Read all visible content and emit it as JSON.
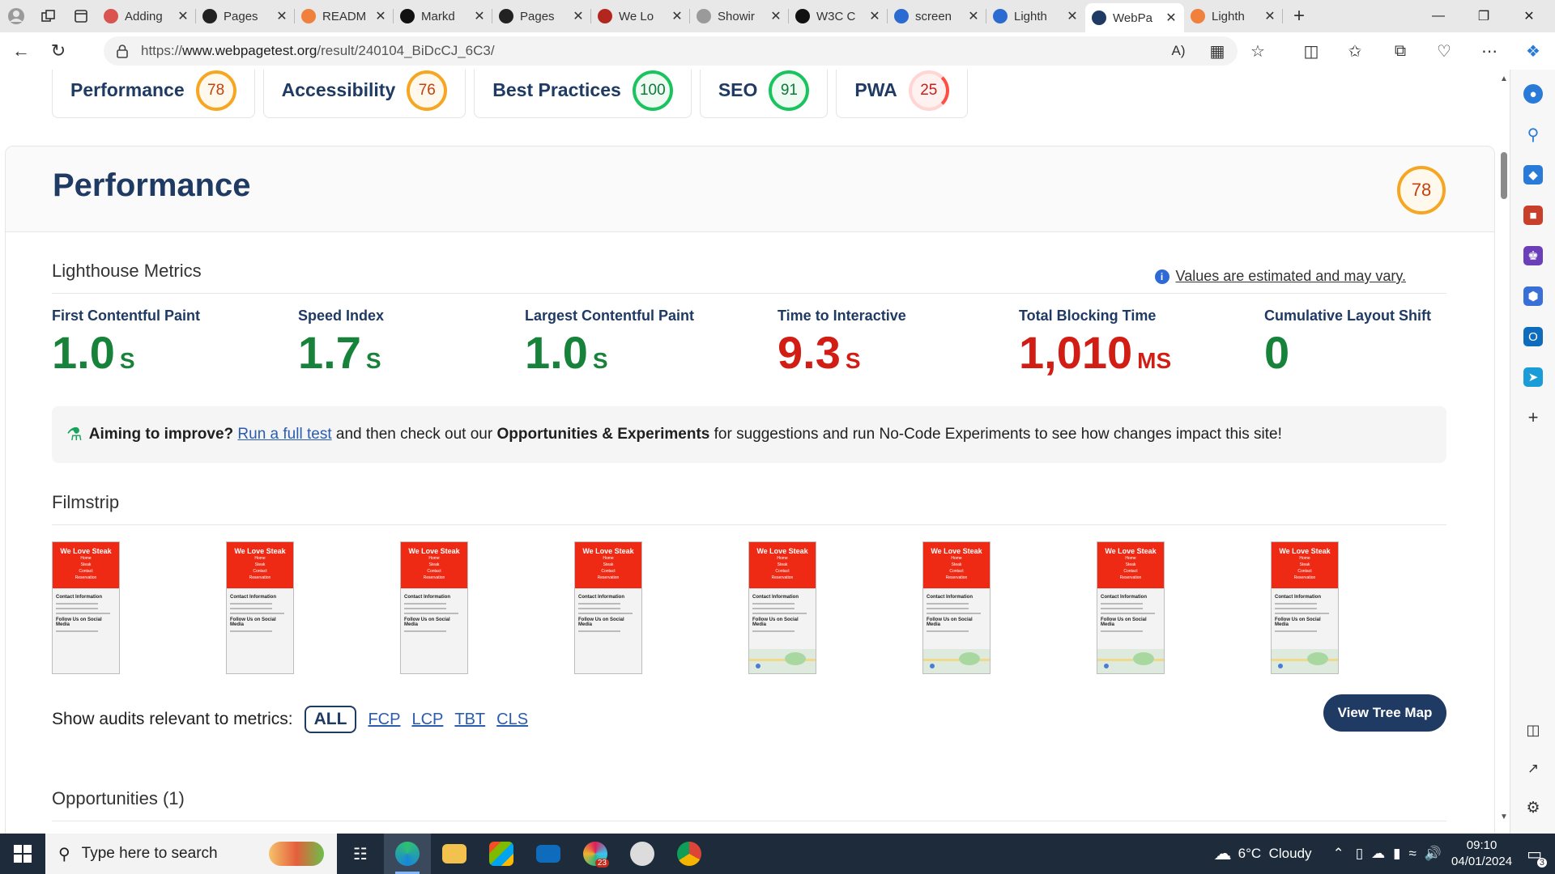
{
  "browser": {
    "tabs": [
      {
        "label": "Adding",
        "icon": "circle-favicon-icon",
        "color": "#d9534f"
      },
      {
        "label": "Pages",
        "icon": "github-icon",
        "color": "#222222"
      },
      {
        "label": "READM",
        "icon": "compass-favicon-icon",
        "color": "#f0803c"
      },
      {
        "label": "Markd",
        "icon": "markdown-icon",
        "color": "#111111"
      },
      {
        "label": "Pages",
        "icon": "github-icon",
        "color": "#222222"
      },
      {
        "label": "We Lo",
        "icon": "steak-favicon-icon",
        "color": "#b3261e"
      },
      {
        "label": "Showir",
        "icon": "cat-favicon-icon",
        "color": "#9a9a9a"
      },
      {
        "label": "W3C C",
        "icon": "w3c-icon",
        "color": "#111111"
      },
      {
        "label": "screen",
        "icon": "search-favicon-icon",
        "color": "#2a6ad1"
      },
      {
        "label": "Lighth",
        "icon": "search-favicon-icon",
        "color": "#2a6ad1"
      },
      {
        "label": "WebPa",
        "icon": "webpagetest-icon",
        "color": "#1f3a63"
      },
      {
        "label": "Lighth",
        "icon": "lighthouse-icon",
        "color": "#f0803c"
      }
    ],
    "url_prefix": "https://",
    "url_domain": "www.webpagetest.org",
    "url_path": "/result/240104_BiDcCJ_6C3/"
  },
  "categories": [
    {
      "label": "Performance",
      "score": "78",
      "status": "orange"
    },
    {
      "label": "Accessibility",
      "score": "76",
      "status": "orange"
    },
    {
      "label": "Best Practices",
      "score": "100",
      "status": "green"
    },
    {
      "label": "SEO",
      "score": "91",
      "status": "green"
    },
    {
      "label": "PWA",
      "score": "25",
      "status": "red"
    }
  ],
  "performance": {
    "title": "Performance",
    "score": "78",
    "metrics_heading": "Lighthouse Metrics",
    "estimate_note": "Values are estimated and may vary.",
    "metrics": [
      {
        "label": "First Contentful Paint",
        "value": "1.0",
        "unit": "S",
        "status": "green"
      },
      {
        "label": "Speed Index",
        "value": "1.7",
        "unit": "S",
        "status": "green"
      },
      {
        "label": "Largest Contentful Paint",
        "value": "1.0",
        "unit": "S",
        "status": "green"
      },
      {
        "label": "Time to Interactive",
        "value": "9.3",
        "unit": "S",
        "status": "red"
      },
      {
        "label": "Total Blocking Time",
        "value": "1,010",
        "unit": "MS",
        "status": "red"
      },
      {
        "label": "Cumulative Layout Shift",
        "value": "0",
        "unit": "",
        "status": "green"
      }
    ],
    "improve": {
      "lead": "Aiming to improve?",
      "link": "Run a full test",
      "mid": " and then check out our ",
      "bold": "Opportunities & Experiments",
      "tail": " for suggestions and run No-Code Experiments to see how changes impact this site!"
    },
    "filmstrip_heading": "Filmstrip",
    "filmstrip": {
      "frame_title": "We Love Steak",
      "frame_nav": [
        "Home",
        "Steak",
        "Contact",
        "Reservation"
      ],
      "frame_h1": "Contact Information",
      "frame_h2": "Follow Us on Social Media",
      "frames_with_map": [
        false,
        false,
        false,
        false,
        true,
        true,
        true,
        true
      ]
    },
    "audits_label": "Show audits relevant to metrics:",
    "audit_filters": [
      "ALL",
      "FCP",
      "LCP",
      "TBT",
      "CLS"
    ],
    "tree_map_button": "View Tree Map",
    "opportunities_heading": "Opportunities (1)"
  },
  "taskbar": {
    "search_placeholder": "Type here to search",
    "weather": "6°C  Cloudy",
    "time": "09:10",
    "date": "04/01/2024",
    "notif_count": "3",
    "badge_count": "23"
  }
}
